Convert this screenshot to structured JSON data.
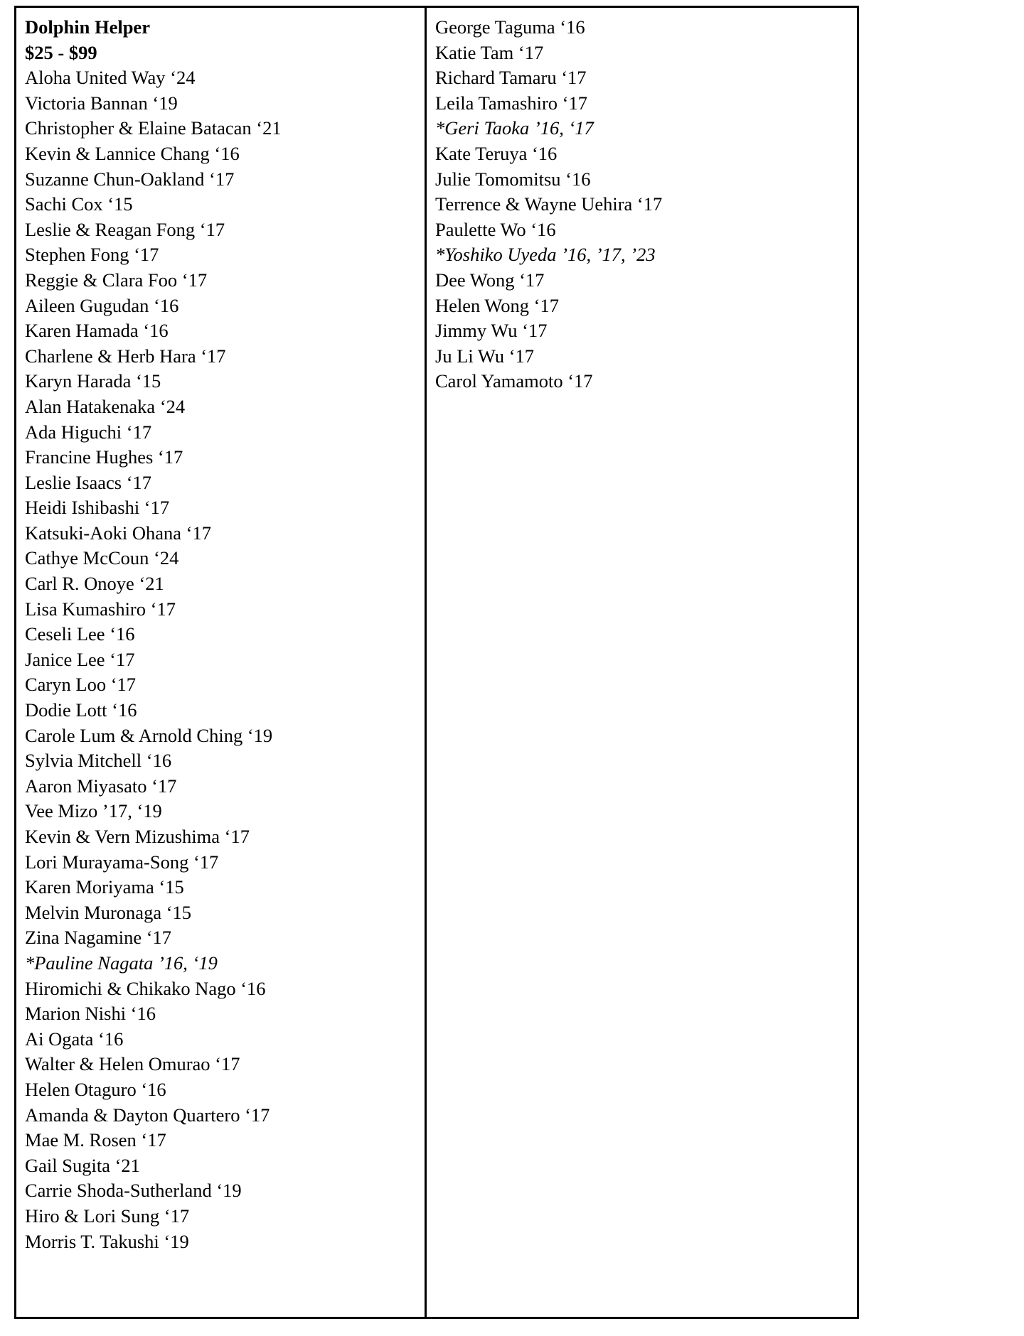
{
  "document": {
    "title": "Dolphin Helper",
    "amount_range": "$25 - $99"
  },
  "columns": {
    "left": {
      "heading_lines": [
        {
          "text": "Dolphin Helper",
          "style": "bold"
        },
        {
          "text": "$25 - $99",
          "style": "bold"
        }
      ],
      "entries": [
        {
          "text": "Aloha United Way ‘24",
          "style": "normal"
        },
        {
          "text": "Victoria Bannan ‘19",
          "style": "normal"
        },
        {
          "text": "Christopher & Elaine Batacan ‘21",
          "style": "normal"
        },
        {
          "text": "Kevin & Lannice Chang ‘16",
          "style": "normal"
        },
        {
          "text": "Suzanne Chun-Oakland ‘17",
          "style": "normal"
        },
        {
          "text": "Sachi Cox ‘15",
          "style": "normal"
        },
        {
          "text": "Leslie & Reagan Fong ‘17",
          "style": "normal"
        },
        {
          "text": "Stephen Fong ‘17",
          "style": "normal"
        },
        {
          "text": "Reggie & Clara Foo ‘17",
          "style": "normal"
        },
        {
          "text": "Aileen Gugudan ‘16",
          "style": "normal"
        },
        {
          "text": "Karen Hamada ‘16",
          "style": "normal"
        },
        {
          "text": "Charlene & Herb Hara ‘17",
          "style": "normal"
        },
        {
          "text": "Karyn Harada ‘15",
          "style": "normal"
        },
        {
          "text": "Alan Hatakenaka ‘24",
          "style": "normal"
        },
        {
          "text": "Ada Higuchi ‘17",
          "style": "normal"
        },
        {
          "text": "Francine Hughes ‘17",
          "style": "normal"
        },
        {
          "text": "Leslie Isaacs ‘17",
          "style": "normal"
        },
        {
          "text": "Heidi Ishibashi ‘17",
          "style": "normal"
        },
        {
          "text": "Katsuki-Aoki Ohana ‘17",
          "style": "normal"
        },
        {
          "text": "Cathye McCoun ‘24",
          "style": "normal"
        },
        {
          "text": "Carl R. Onoye ‘21",
          "style": "normal"
        },
        {
          "text": "Lisa Kumashiro ‘17",
          "style": "normal"
        },
        {
          "text": "Ceseli Lee ‘16",
          "style": "normal"
        },
        {
          "text": "Janice Lee ‘17",
          "style": "normal"
        },
        {
          "text": "Caryn Loo ‘17",
          "style": "normal"
        },
        {
          "text": "Dodie Lott ‘16",
          "style": "normal"
        },
        {
          "text": "Carole Lum & Arnold Ching ‘19",
          "style": "normal"
        },
        {
          "text": "Sylvia Mitchell ‘16",
          "style": "normal"
        },
        {
          "text": "Aaron Miyasato ‘17",
          "style": "normal"
        },
        {
          "text": "Vee Mizo ’17, ‘19",
          "style": "normal"
        },
        {
          "text": "Kevin & Vern Mizushima ‘17",
          "style": "normal"
        },
        {
          "text": "Lori Murayama-Song ‘17",
          "style": "normal"
        },
        {
          "text": "Karen Moriyama ‘15",
          "style": "normal"
        },
        {
          "text": "Melvin Muronaga ‘15",
          "style": "normal"
        },
        {
          "text": "Zina Nagamine ‘17",
          "style": "normal"
        },
        {
          "text": "*Pauline Nagata ’16, ‘19",
          "style": "italic"
        },
        {
          "text": "Hiromichi & Chikako Nago ‘16",
          "style": "normal"
        },
        {
          "text": "Marion Nishi ‘16",
          "style": "normal"
        },
        {
          "text": "Ai Ogata ‘16",
          "style": "normal"
        },
        {
          "text": "Walter & Helen Omurao ‘17",
          "style": "normal"
        },
        {
          "text": "Helen Otaguro ‘16",
          "style": "normal"
        },
        {
          "text": "Amanda & Dayton Quartero ‘17",
          "style": "normal"
        },
        {
          "text": "Mae M. Rosen ‘17",
          "style": "normal"
        },
        {
          "text": "Gail Sugita ‘21",
          "style": "normal"
        },
        {
          "text": "Carrie Shoda-Sutherland ‘19",
          "style": "normal"
        },
        {
          "text": "Hiro & Lori Sung ‘17",
          "style": "normal"
        },
        {
          "text": "Morris T. Takushi ‘19",
          "style": "normal"
        }
      ]
    },
    "right": {
      "entries": [
        {
          "text": "George Taguma ‘16",
          "style": "normal"
        },
        {
          "text": "Katie Tam ‘17",
          "style": "normal"
        },
        {
          "text": "Richard Tamaru ‘17",
          "style": "normal"
        },
        {
          "text": "Leila Tamashiro ‘17",
          "style": "normal"
        },
        {
          "text": "*Geri Taoka ’16, ‘17",
          "style": "italic"
        },
        {
          "text": "Kate Teruya ‘16",
          "style": "normal"
        },
        {
          "text": "Julie Tomomitsu ‘16",
          "style": "normal"
        },
        {
          "text": "Terrence & Wayne Uehira ‘17",
          "style": "normal"
        },
        {
          "text": "Paulette Wo ‘16",
          "style": "normal"
        },
        {
          "text": "*Yoshiko Uyeda ’16, ’17, ’23",
          "style": "italic"
        },
        {
          "text": "Dee Wong ‘17",
          "style": "normal"
        },
        {
          "text": "Helen Wong ‘17",
          "style": "normal"
        },
        {
          "text": "Jimmy Wu ‘17",
          "style": "normal"
        },
        {
          "text": "Ju Li Wu ‘17",
          "style": "normal"
        },
        {
          "text": "Carol Yamamoto ‘17",
          "style": "normal"
        }
      ]
    }
  }
}
